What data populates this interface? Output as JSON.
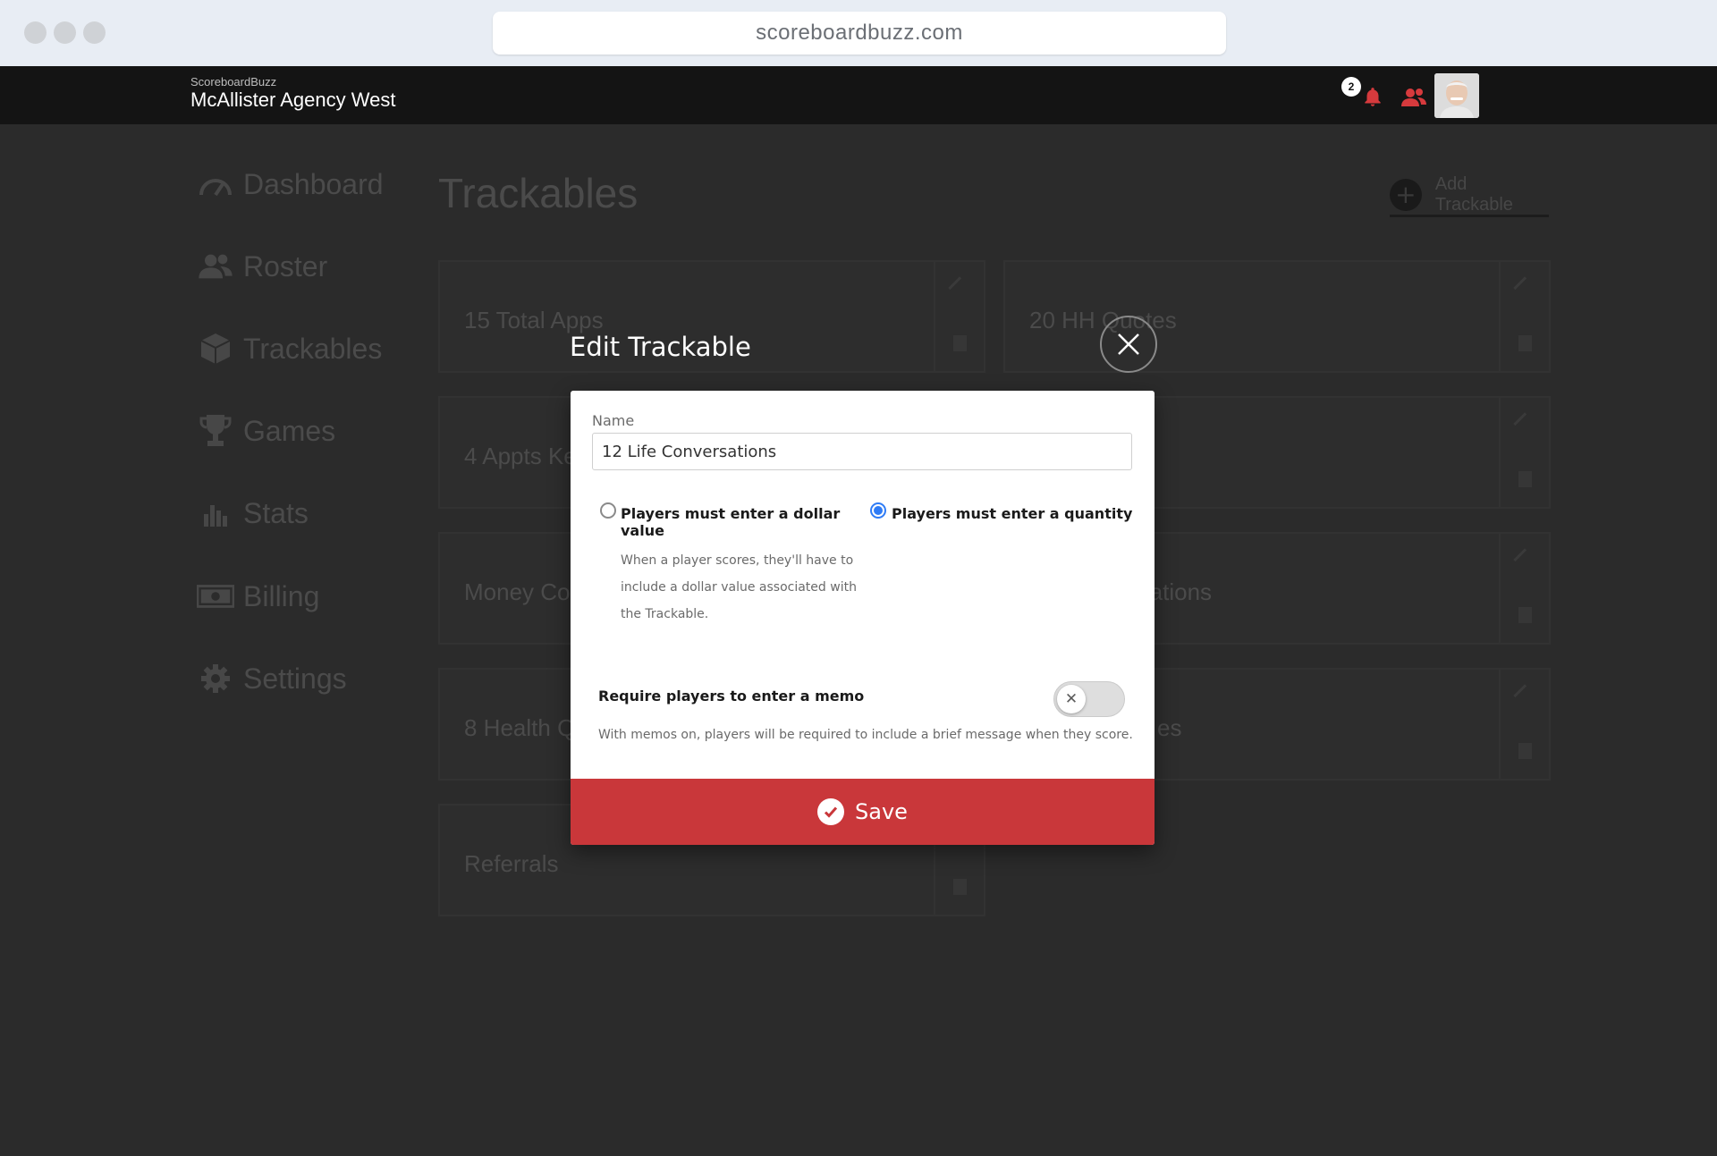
{
  "browser": {
    "url": "scoreboardbuzz.com"
  },
  "header": {
    "app_name": "ScoreboardBuzz",
    "agency_name": "McAllister Agency West",
    "notification_count": "2"
  },
  "sidebar": {
    "items": [
      {
        "label": "Dashboard",
        "icon": "speedometer-icon"
      },
      {
        "label": "Roster",
        "icon": "people-icon"
      },
      {
        "label": "Trackables",
        "icon": "cube-icon"
      },
      {
        "label": "Games",
        "icon": "trophy-icon"
      },
      {
        "label": "Stats",
        "icon": "bar-chart-icon"
      },
      {
        "label": "Billing",
        "icon": "money-icon"
      },
      {
        "label": "Settings",
        "icon": "gear-icon"
      }
    ]
  },
  "main": {
    "title": "Trackables",
    "add_label": "Add Trackable",
    "cards": [
      {
        "label": "15 Total Apps"
      },
      {
        "label": "20 HH Quotes"
      },
      {
        "label": "4 Appts Ke"
      },
      {
        "label": ""
      },
      {
        "label": "Money Co"
      },
      {
        "label": "rsations"
      },
      {
        "label": "8 Health Q"
      },
      {
        "label": "es"
      },
      {
        "label": "Referrals"
      }
    ]
  },
  "modal": {
    "title": "Edit Trackable",
    "name_label": "Name",
    "name_value": "12 Life Conversations",
    "option_dollar": {
      "title": "Players must enter a dollar value",
      "description": "When a player scores, they'll have to include a dollar value associated with the Trackable.",
      "selected": false
    },
    "option_quantity": {
      "title": "Players must enter a quantity",
      "selected": true
    },
    "memo": {
      "title": "Require players to enter a memo",
      "description": "With memos on, players will be required to include a brief message when they score.",
      "enabled": false
    },
    "save_label": "Save"
  },
  "colors": {
    "accent_red": "#c9373a",
    "radio_blue": "#2f7cf6"
  }
}
